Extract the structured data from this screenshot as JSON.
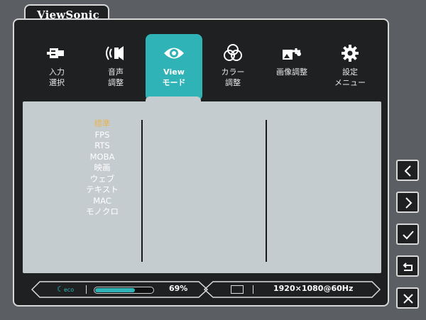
{
  "brand": "ViewSonic",
  "menu": [
    {
      "line1": "入力",
      "line2": "選択"
    },
    {
      "line1": "音声",
      "line2": "調整"
    },
    {
      "line1": "View",
      "line2": "モード"
    },
    {
      "line1": "カラー",
      "line2": "調整"
    },
    {
      "line1": "画像調整",
      "line2": ""
    },
    {
      "line1": "設定",
      "line2": "メニュー"
    }
  ],
  "modes": [
    "標準",
    "FPS",
    "RTS",
    "MOBA",
    "映画",
    "ウェブ",
    "テキスト",
    "MAC",
    "モノクロ"
  ],
  "selected_mode": "標準",
  "status": {
    "eco_label": "eco",
    "eco_level": 0.69,
    "eco_percent": "69%",
    "resolution": "1920×1080@60Hz"
  },
  "side_buttons": [
    "left-arrow-icon",
    "right-arrow-icon",
    "check-icon",
    "return-icon",
    "close-icon"
  ],
  "colors": {
    "accent": "#2fb3b6",
    "selected_mode": "#e2b65a",
    "panel": "#c5ccd0",
    "frame": "#1e2022"
  }
}
